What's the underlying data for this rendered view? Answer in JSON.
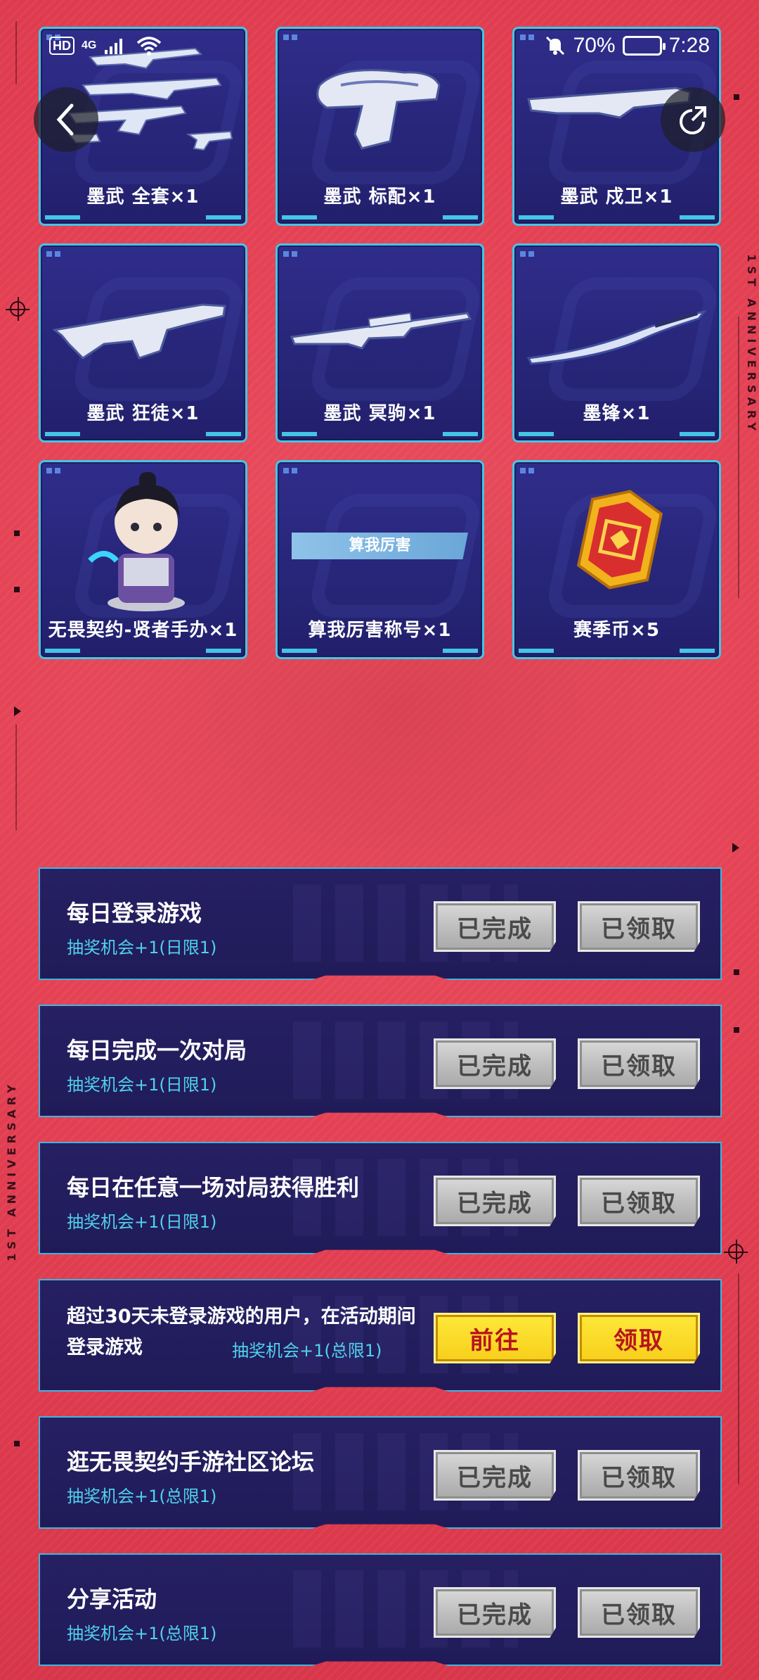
{
  "status_bar": {
    "hd": "HD",
    "network": "4G",
    "battery": "70%",
    "time": "7:28"
  },
  "decor": {
    "anniversary": "1ST ANNIVERSARY"
  },
  "rewards": [
    {
      "label": "墨武 全套×1"
    },
    {
      "label": "墨武 标配×1"
    },
    {
      "label": "墨武 戍卫×1"
    },
    {
      "label": "墨武 狂徒×1"
    },
    {
      "label": "墨武 冥驹×1"
    },
    {
      "label": "墨锋×1"
    },
    {
      "label": "无畏契约-贤者手办×1"
    },
    {
      "label": "算我厉害称号×1",
      "badge": "算我厉害"
    },
    {
      "label": "赛季币×5"
    }
  ],
  "tasks": [
    {
      "title": "每日登录游戏",
      "sub": "抽奖机会+1(日限1)",
      "btn1": "已完成",
      "btn2": "已领取"
    },
    {
      "title": "每日完成一次对局",
      "sub": "抽奖机会+1(日限1)",
      "btn1": "已完成",
      "btn2": "已领取"
    },
    {
      "title": "每日在任意一场对局获得胜利",
      "sub": "抽奖机会+1(日限1)",
      "btn1": "已完成",
      "btn2": "已领取"
    },
    {
      "title": "超过30天未登录游戏的用户，在活动期间登录游戏",
      "sub": "抽奖机会+1(总限1)",
      "btn1": "前往",
      "btn2": "领取"
    },
    {
      "title": "逛无畏契约手游社区论坛",
      "sub": "抽奖机会+1(总限1)",
      "btn1": "已完成",
      "btn2": "已领取"
    },
    {
      "title": "分享活动",
      "sub": "抽奖机会+1(总限1)",
      "btn1": "已完成",
      "btn2": "已领取"
    }
  ],
  "colors": {
    "background": "#e84455",
    "card": "#2a2880",
    "card_border": "#45c5e6",
    "task_sub": "#4fd1ec",
    "yellow_button": "#f7cf1b",
    "yellow_button_text": "#b8141e"
  }
}
